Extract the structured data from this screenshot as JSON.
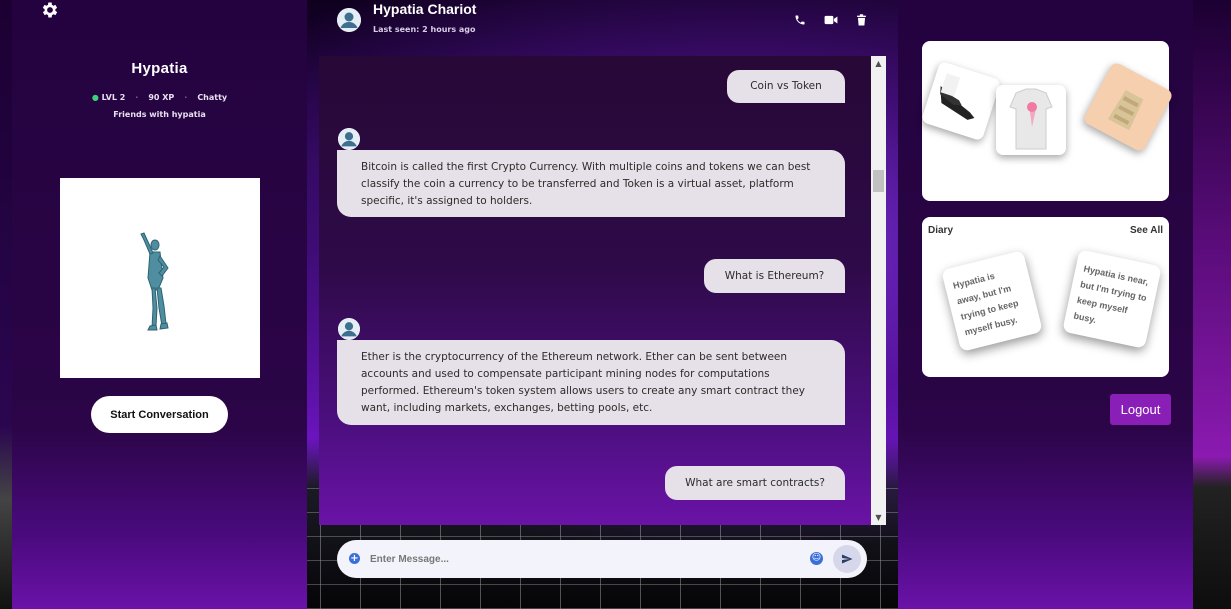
{
  "profile": {
    "name": "Hypatia",
    "level": "LVL 2",
    "xp": "90 XP",
    "trait": "Chatty",
    "friends": "Friends with hypatia",
    "start_button": "Start Conversation"
  },
  "chat": {
    "title": "Hypatia Chariot",
    "last_seen": "Last seen: 2 hours ago",
    "messages": [
      {
        "side": "out",
        "text": "Coin vs Token"
      },
      {
        "side": "in",
        "text": "Bitcoin is called the first Crypto Currency. With multiple coins and tokens we can best classify the coin a currency to be transferred and Token is a virtual asset, platform specific, it's assigned to holders."
      },
      {
        "side": "out",
        "text": "What is Ethereum?"
      },
      {
        "side": "in",
        "text": "Ether is the cryptocurrency of the Ethereum network. Ether can be sent between accounts and used to compensate participant mining nodes for computations performed. Ethereum's token system allows users to create any smart contract they want, including markets, exchanges, betting pools, etc."
      },
      {
        "side": "out",
        "text": "What are smart contracts?"
      }
    ],
    "input_placeholder": "Enter Message..."
  },
  "diary": {
    "title": "Diary",
    "see_all": "See All",
    "notes": [
      "Hypatia is away, but I'm trying to keep myself busy.",
      "Hypatia is near, but I'm trying to keep myself busy."
    ]
  },
  "logout": "Logout",
  "icons": {
    "settings": "gear-icon",
    "call": "phone-icon",
    "video": "video-icon",
    "delete": "trash-icon",
    "attach": "plus-icon",
    "emoji": "emoji-icon",
    "send": "send-icon"
  },
  "colors": {
    "panel": "#2b0547",
    "accent": "#8a1fb8",
    "bubble": "#e6e1e8",
    "input_icons": "#3b6fd8"
  }
}
